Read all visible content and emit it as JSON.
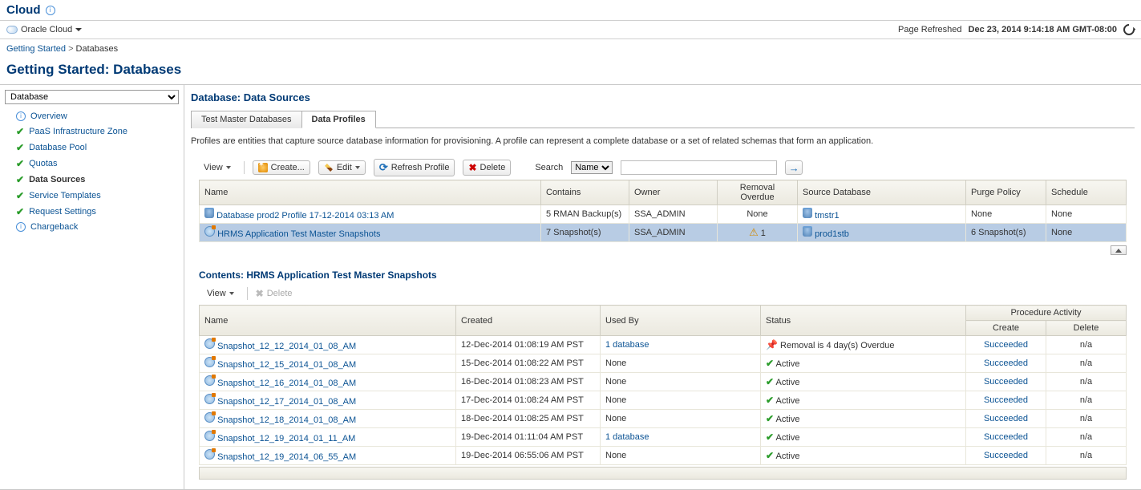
{
  "header": {
    "title": "Cloud",
    "cloud_menu": "Oracle Cloud",
    "refresh_prefix": "Page Refreshed",
    "refresh_time": "Dec 23, 2014 9:14:18 AM GMT-08:00"
  },
  "breadcrumbs": {
    "getting_started": "Getting Started",
    "databases": "Databases"
  },
  "page_title": "Getting Started: Databases",
  "sidebar": {
    "select_value": "Database",
    "items": [
      {
        "label": "Overview",
        "icon": "info"
      },
      {
        "label": "PaaS Infrastructure Zone",
        "icon": "check"
      },
      {
        "label": "Database Pool",
        "icon": "check"
      },
      {
        "label": "Quotas",
        "icon": "check"
      },
      {
        "label": "Data Sources",
        "icon": "check",
        "bold": true
      },
      {
        "label": "Service Templates",
        "icon": "check"
      },
      {
        "label": "Request Settings",
        "icon": "check"
      },
      {
        "label": "Chargeback",
        "icon": "info"
      }
    ]
  },
  "panel": {
    "title": "Database: Data Sources",
    "tabs": [
      "Test Master Databases",
      "Data Profiles"
    ],
    "active_tab": 1,
    "description": "Profiles are entities that capture source database information for provisioning. A profile can represent a complete database or a set of related schemas that form an application."
  },
  "toolbar": {
    "view": "View",
    "create": "Create...",
    "edit": "Edit",
    "refresh": "Refresh Profile",
    "delete": "Delete",
    "search": "Search",
    "search_by": "Name",
    "search_value": ""
  },
  "profiles": {
    "cols": [
      "Name",
      "Contains",
      "Owner",
      "Removal Overdue",
      "Source Database",
      "Purge Policy",
      "Schedule"
    ],
    "rows": [
      {
        "name": "Database prod2 Profile 17-12-2014 03:13 AM",
        "icon": "db",
        "contains": "5 RMAN Backup(s)",
        "owner": "SSA_ADMIN",
        "overdue": "None",
        "src": "tmstr1",
        "purge": "None",
        "sched": "None",
        "selected": false
      },
      {
        "name": "HRMS Application Test Master Snapshots",
        "icon": "snap",
        "contains": "7 Snapshot(s)",
        "owner": "SSA_ADMIN",
        "overdue": "1",
        "overdue_warn": true,
        "src": "prod1stb",
        "purge": "6 Snapshot(s)",
        "sched": "None",
        "selected": true
      }
    ]
  },
  "contents": {
    "title": "Contents: HRMS Application Test Master Snapshots",
    "view": "View",
    "delete": "Delete",
    "cols": {
      "name": "Name",
      "created": "Created",
      "used": "Used By",
      "status": "Status",
      "proc": "Procedure Activity",
      "create": "Create",
      "del": "Delete"
    },
    "rows": [
      {
        "name": "Snapshot_12_12_2014_01_08_AM",
        "created": "12-Dec-2014 01:08:19 AM PST",
        "used": "1 database",
        "used_link": true,
        "status": "Removal is 4 day(s) Overdue",
        "status_ic": "pin",
        "create": "Succeeded",
        "del": "n/a"
      },
      {
        "name": "Snapshot_12_15_2014_01_08_AM",
        "created": "15-Dec-2014 01:08:22 AM PST",
        "used": "None",
        "status": "Active",
        "status_ic": "ok",
        "create": "Succeeded",
        "del": "n/a"
      },
      {
        "name": "Snapshot_12_16_2014_01_08_AM",
        "created": "16-Dec-2014 01:08:23 AM PST",
        "used": "None",
        "status": "Active",
        "status_ic": "ok",
        "create": "Succeeded",
        "del": "n/a"
      },
      {
        "name": "Snapshot_12_17_2014_01_08_AM",
        "created": "17-Dec-2014 01:08:24 AM PST",
        "used": "None",
        "status": "Active",
        "status_ic": "ok",
        "create": "Succeeded",
        "del": "n/a"
      },
      {
        "name": "Snapshot_12_18_2014_01_08_AM",
        "created": "18-Dec-2014 01:08:25 AM PST",
        "used": "None",
        "status": "Active",
        "status_ic": "ok",
        "create": "Succeeded",
        "del": "n/a"
      },
      {
        "name": "Snapshot_12_19_2014_01_11_AM",
        "created": "19-Dec-2014 01:11:04 AM PST",
        "used": "1 database",
        "used_link": true,
        "status": "Active",
        "status_ic": "ok",
        "create": "Succeeded",
        "del": "n/a"
      },
      {
        "name": "Snapshot_12_19_2014_06_55_AM",
        "created": "19-Dec-2014 06:55:06 AM PST",
        "used": "None",
        "status": "Active",
        "status_ic": "ok",
        "create": "Succeeded",
        "del": "n/a"
      }
    ]
  }
}
